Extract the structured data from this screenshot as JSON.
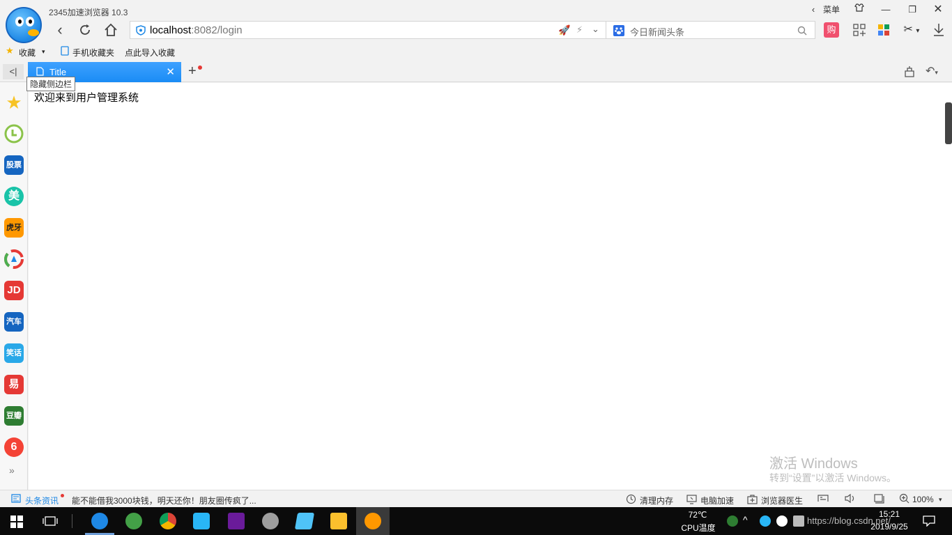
{
  "window": {
    "app_title": "2345加速浏览器 10.3",
    "menu_label": "菜单"
  },
  "address_bar": {
    "url_host": "localhost",
    "url_rest": ":8082/login"
  },
  "search_bar": {
    "placeholder": "今日新闻头条"
  },
  "toolbar": {
    "shop_label": "购"
  },
  "bookmarks": {
    "favorites": "收藏",
    "mobile": "手机收藏夹",
    "import": "点此导入收藏"
  },
  "tab": {
    "title": "Title"
  },
  "tooltip": "隐藏侧边栏",
  "sidebar": {
    "items": [
      {
        "label": "",
        "color": "#f7c325"
      },
      {
        "label": "",
        "color": "#8bc34a"
      },
      {
        "label": "股票",
        "color": "#1565c0"
      },
      {
        "label": "美",
        "color": "#19c3a8"
      },
      {
        "label": "虎牙",
        "color": "#ff9800"
      },
      {
        "label": "",
        "color": "#e53935"
      },
      {
        "label": "JD",
        "color": "#e53935"
      },
      {
        "label": "汽车",
        "color": "#1565c0"
      },
      {
        "label": "笑话",
        "color": "#29a8e8"
      },
      {
        "label": "易",
        "color": "#e53935"
      },
      {
        "label": "豆瓣",
        "color": "#2e7d32"
      },
      {
        "label": "6",
        "color": "#f44336"
      }
    ],
    "more": "»"
  },
  "page": {
    "welcome": "欢迎来到用户管理系统"
  },
  "watermark": {
    "line1": "激活 Windows",
    "line2": "转到“设置”以激活 Windows。"
  },
  "statusbar": {
    "news_label": "头条资讯",
    "news_text": "能不能借我3000块钱，明天还你！朋友圈传疯了...",
    "clean_memory": "清理内存",
    "speedup": "电脑加速",
    "doctor": "浏览器医生",
    "zoom": "100%"
  },
  "taskbar": {
    "temp": "72℃",
    "cpu_label": "CPU温度",
    "time": "15:21",
    "date": "2019/9/25",
    "overlay_url": "https://blog.csdn.net/Sunxn"
  },
  "colors": {
    "tab_active": "#1a8cf5",
    "accent": "#1e88e5"
  }
}
